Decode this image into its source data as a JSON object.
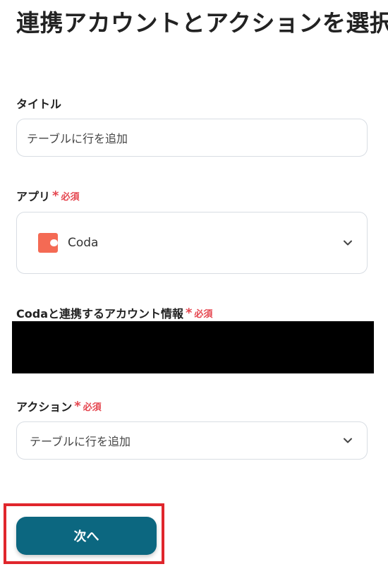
{
  "page": {
    "title": "連携アカウントとアクションを選択"
  },
  "fields": {
    "title_label": "タイトル",
    "title_value": "テーブルに行を追加",
    "app_label": "アプリ",
    "app_name": "Coda",
    "account_label": "Codaと連携するアカウント情報",
    "action_label": "アクション",
    "action_value": "テーブルに行を追加"
  },
  "required": {
    "star": "*",
    "text": "必須"
  },
  "actions": {
    "next_label": "次へ"
  },
  "icons": {
    "app_icon": "coda-logo-icon",
    "chevron": "chevron-down-icon"
  },
  "colors": {
    "required": "#e5464f",
    "primary_button": "#0c6780",
    "coda_brand": "#f46a54",
    "highlight": "#e0262c"
  }
}
